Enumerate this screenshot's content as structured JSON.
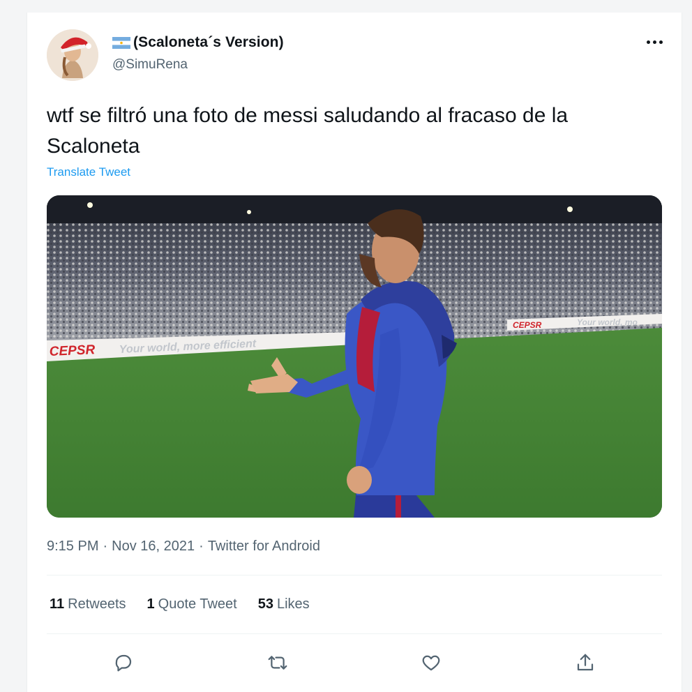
{
  "tweet": {
    "display_name": "(Scaloneta´s Version)",
    "handle": "@SimuRena",
    "text": "wtf se filtró una foto de messi saludando al fracaso de la Scaloneta",
    "translate_label": "Translate Tweet",
    "time": "9:15 PM",
    "date": "Nov 16, 2021",
    "source": "Twitter for Android",
    "separator": "·"
  },
  "media": {
    "ad_board_left": "CEPSR",
    "ad_board_left_slogan": "Your world, more efficient",
    "ad_board_right": "CEPSR",
    "ad_board_right_slogan": "Your world, mo"
  },
  "stats": {
    "retweets_count": "11",
    "retweets_label": "Retweets",
    "quotes_count": "1",
    "quotes_label": "Quote Tweet",
    "likes_count": "53",
    "likes_label": "Likes"
  },
  "icons": {
    "flag": "argentina-flag-icon",
    "more": "more-icon",
    "reply": "reply-icon",
    "retweet": "retweet-icon",
    "like": "like-icon",
    "share": "share-icon"
  },
  "colors": {
    "link": "#1d9bf0",
    "secondary_text": "#536471",
    "primary_text": "#0f1419"
  }
}
